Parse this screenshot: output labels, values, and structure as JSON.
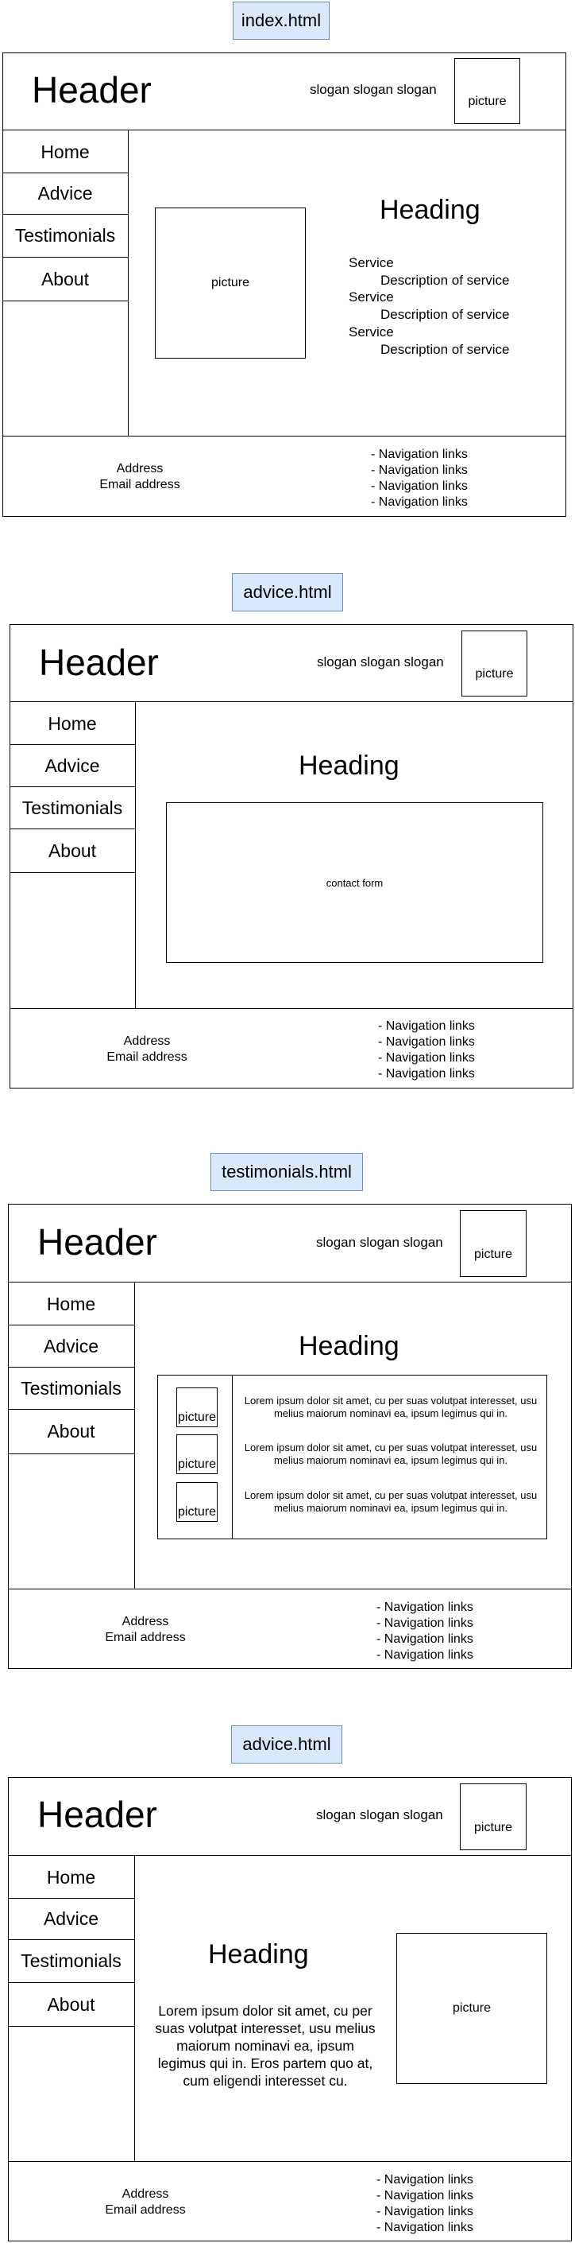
{
  "common": {
    "header": "Header",
    "slogan": "slogan slogan slogan",
    "picture": "picture",
    "nav": [
      "Home",
      "Advice",
      "Testimonials",
      "About"
    ],
    "heading": "Heading",
    "footer_address": "Address",
    "footer_email": "Email address",
    "footer_links": [
      "- Navigation links",
      "- Navigation links",
      "- Navigation links",
      "- Navigation links"
    ]
  },
  "pages": [
    {
      "title": "index.html",
      "services": [
        {
          "label": "Service",
          "description": "Description of service"
        },
        {
          "label": "Service",
          "description": "Description of service"
        },
        {
          "label": "Service",
          "description": "Description of service"
        }
      ]
    },
    {
      "title": "advice.html",
      "form_label": "contact form"
    },
    {
      "title": "testimonials.html",
      "testimonials": [
        "Lorem ipsum dolor sit amet, cu per suas volutpat interesset, usu melius maiorum nominavi ea, ipsum legimus qui in.",
        "Lorem ipsum dolor sit amet, cu per suas volutpat interesset, usu melius maiorum nominavi ea, ipsum legimus qui in.",
        "Lorem ipsum dolor sit amet, cu per suas volutpat interesset, usu melius maiorum nominavi ea, ipsum legimus qui in."
      ]
    },
    {
      "title": "advice.html",
      "body_text": "Lorem ipsum dolor sit amet, cu per suas volutpat interesset, usu melius maiorum nominavi ea, ipsum legimus qui in. Eros partem quo at, cum eligendi interesset cu."
    }
  ]
}
